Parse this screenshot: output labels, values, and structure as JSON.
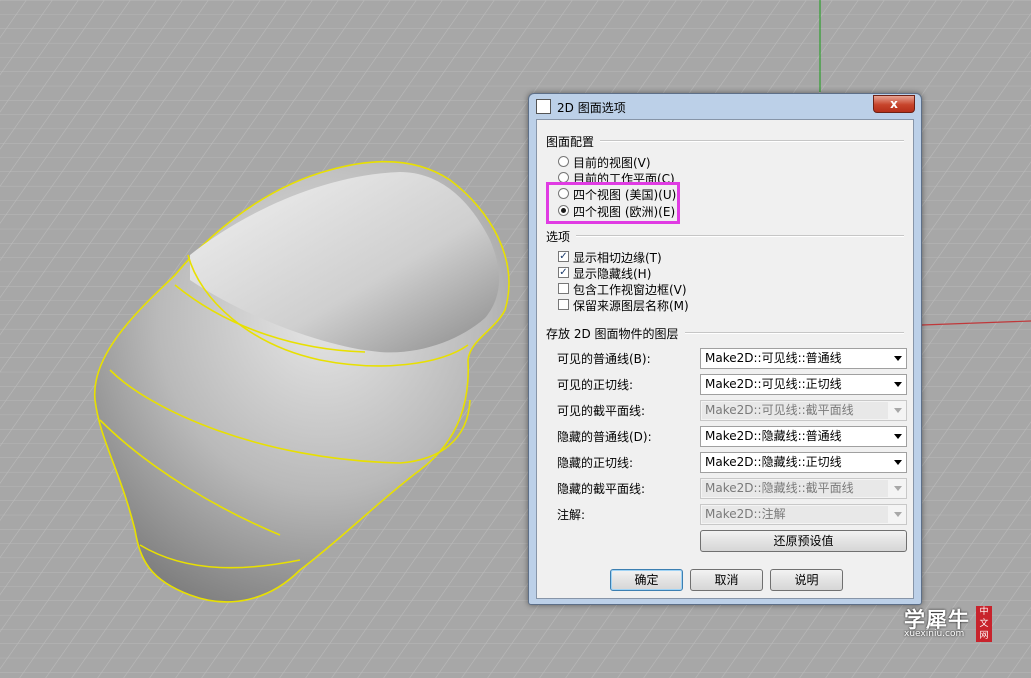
{
  "dialog": {
    "title": "2D 图面选项",
    "close_label": "x"
  },
  "layout_section": {
    "heading": "图面配置",
    "options": [
      {
        "label": "目前的视图(V)",
        "checked": false
      },
      {
        "label": "目前的工作平面(C)",
        "checked": false
      },
      {
        "label": "四个视图 (美国)(U)",
        "checked": false
      },
      {
        "label": "四个视图 (欧洲)(E)",
        "checked": true
      }
    ]
  },
  "options_section": {
    "heading": "选项",
    "checks": [
      {
        "label": "显示相切边缘(T)",
        "checked": true
      },
      {
        "label": "显示隐藏线(H)",
        "checked": true
      },
      {
        "label": "包含工作视窗边框(V)",
        "checked": false
      },
      {
        "label": "保留来源图层名称(M)",
        "checked": false
      }
    ]
  },
  "layers_section": {
    "heading": "存放 2D 图面物件的图层",
    "rows": [
      {
        "label": "可见的普通线(B):",
        "value": "Make2D::可见线::普通线",
        "enabled": true
      },
      {
        "label": "可见的正切线:",
        "value": "Make2D::可见线::正切线",
        "enabled": true
      },
      {
        "label": "可见的截平面线:",
        "value": "Make2D::可见线::截平面线",
        "enabled": false
      },
      {
        "label": "隐藏的普通线(D):",
        "value": "Make2D::隐藏线::普通线",
        "enabled": true
      },
      {
        "label": "隐藏的正切线:",
        "value": "Make2D::隐藏线::正切线",
        "enabled": true
      },
      {
        "label": "隐藏的截平面线:",
        "value": "Make2D::隐藏线::截平面线",
        "enabled": false
      },
      {
        "label": "注解:",
        "value": "Make2D::注解",
        "enabled": false
      }
    ],
    "restore_label": "还原预设值"
  },
  "buttons": {
    "ok": "确定",
    "cancel": "取消",
    "help": "说明"
  },
  "watermark": {
    "main": "学犀牛",
    "sub": "xuexiniu.com",
    "badge": "中文网"
  },
  "colors": {
    "highlight": "#e03be3",
    "arrow": "#e8322d",
    "model_edge": "#e8e000",
    "axis_green": "#2ea02e",
    "axis_red": "#c0383a"
  }
}
